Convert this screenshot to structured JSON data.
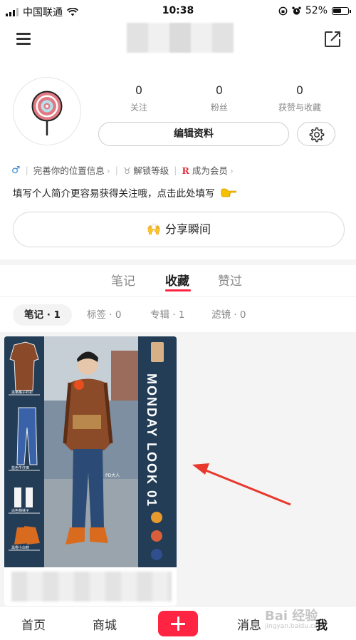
{
  "status_bar": {
    "carrier": "中国联通",
    "time": "10:38",
    "battery": "52%"
  },
  "profile": {
    "stats": [
      {
        "value": "0",
        "label": "关注"
      },
      {
        "value": "0",
        "label": "粉丝"
      },
      {
        "value": "0",
        "label": "获赞与收藏"
      }
    ],
    "edit_label": "编辑资料",
    "tags": {
      "gender_symbol": "♂",
      "location": "完善你的位置信息",
      "level": "解锁等级",
      "member_r": "R",
      "member": "成为会员"
    },
    "bio": "填写个人简介更容易获得关注哦，点击此处填写",
    "share_moment": "分享瞬间"
  },
  "tabs": [
    {
      "label": "笔记",
      "active": false
    },
    {
      "label": "收藏",
      "active": true
    },
    {
      "label": "赞过",
      "active": false
    }
  ],
  "filters": [
    {
      "label": "笔记 · 1",
      "active": true
    },
    {
      "label": "标签 · 0",
      "active": false
    },
    {
      "label": "专辑 · 1",
      "active": false
    },
    {
      "label": "滤镜 · 0",
      "active": false
    }
  ],
  "card": {
    "vertical_title": "MONDAY LOOK 01",
    "clothes_labels": [
      "黑格格子衬衫",
      "蓝色牛仔裤",
      "白色棉袜子",
      "黑橙小白鞋"
    ],
    "photo_caption": "PD大人"
  },
  "bottom_nav": {
    "home": "首页",
    "shop": "商城",
    "messages": "消息",
    "me": "我"
  },
  "watermark": {
    "main": "Bai 经验",
    "sub": "jingyan.baidu.com"
  },
  "colors": {
    "accent": "#ff2442",
    "card_bg": "#233d57"
  }
}
